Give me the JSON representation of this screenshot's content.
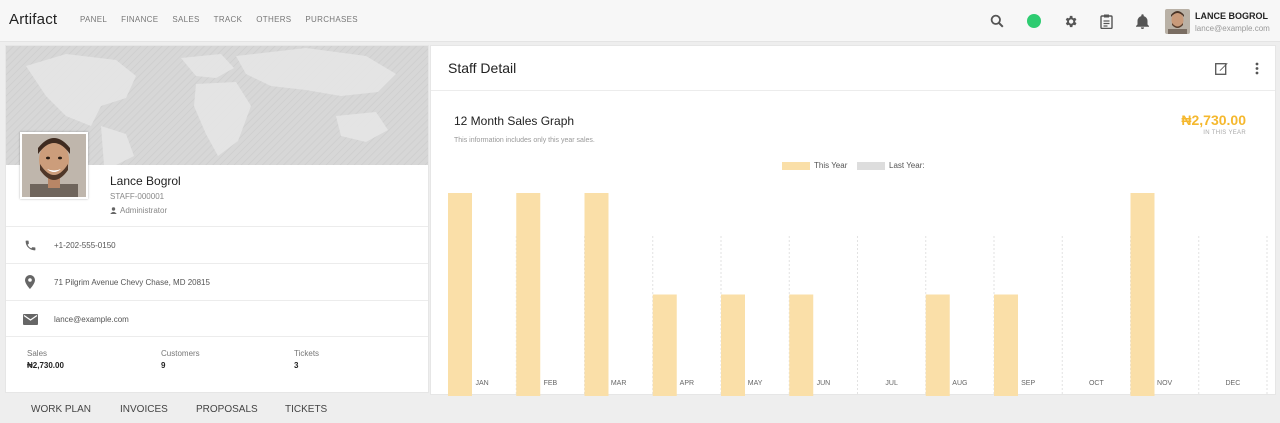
{
  "brand": "Artifact",
  "nav": [
    "PANEL",
    "FINANCE",
    "SALES",
    "TRACK",
    "OTHERS",
    "PURCHASES"
  ],
  "topbar_icons": [
    "search-icon",
    "status-dot",
    "gear-icon",
    "clipboard-icon",
    "bell-icon"
  ],
  "user": {
    "name": "LANCE BOGROL",
    "email": "lance@example.com"
  },
  "profile": {
    "name": "Lance Bogrol",
    "staff_id": "STAFF-000001",
    "role": "Administrator",
    "phone": "+1-202-555-0150",
    "address": "71 Pilgrim Avenue Chevy Chase, MD 20815",
    "email": "lance@example.com"
  },
  "stats": [
    {
      "label": "Sales",
      "value": "₦2,730.00"
    },
    {
      "label": "Customers",
      "value": "9"
    },
    {
      "label": "Tickets",
      "value": "3"
    }
  ],
  "tabs": [
    "WORK PLAN",
    "INVOICES",
    "PROPOSALS",
    "TICKETS"
  ],
  "panel": {
    "title": "Staff Detail"
  },
  "graph": {
    "title": "12 Month Sales Graph",
    "subtitle": "This information includes only this year sales.",
    "total": "₦2,730.00",
    "total_label": "IN THIS YEAR"
  },
  "colors": {
    "this_year": "#fadfa8",
    "last_year": "#dddddd",
    "accent": "#f5b82e",
    "status_green": "#2ecc71"
  },
  "chart_data": {
    "type": "bar",
    "categories": [
      "JAN",
      "FEB",
      "MAR",
      "APR",
      "MAY",
      "JUN",
      "JUL",
      "AUG",
      "SEP",
      "OCT",
      "NOV",
      "DEC"
    ],
    "series": [
      {
        "name": "This Year",
        "values": [
          2,
          2,
          2,
          1,
          1,
          1,
          0,
          1,
          1,
          0,
          2,
          0
        ]
      },
      {
        "name": "Last Year:",
        "values": [
          0,
          0,
          0,
          0,
          0,
          0,
          0,
          0,
          0,
          0,
          0,
          0
        ]
      }
    ],
    "ylim": [
      0,
      2
    ],
    "legend": "top-center",
    "grid": true
  }
}
